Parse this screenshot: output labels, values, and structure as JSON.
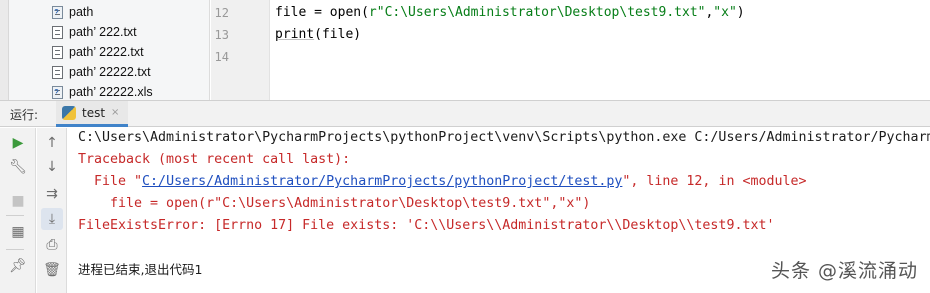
{
  "project_tree": {
    "items": [
      {
        "label": "path",
        "icon": "unknown-file-icon"
      },
      {
        "label": "path’ 222.txt",
        "icon": "text-file-icon"
      },
      {
        "label": "path’ 2222.txt",
        "icon": "text-file-icon"
      },
      {
        "label": "path’ 22222.txt",
        "icon": "text-file-icon"
      },
      {
        "label": "path’ 22222.xls",
        "icon": "unknown-file-icon"
      }
    ]
  },
  "editor": {
    "line_numbers": [
      "12",
      "13",
      "14"
    ],
    "lines": {
      "l12_a": "file = open(",
      "l12_b": "r\"C:\\Users\\Administrator\\Desktop\\test9.txt\"",
      "l12_c": ",",
      "l12_d": "\"x\"",
      "l12_e": ")",
      "l13_a": "print",
      "l13_b": "(file)"
    }
  },
  "run_window": {
    "title": "运行:",
    "tab_label": "test",
    "tab_close": "×"
  },
  "toolbar": {
    "left": [
      "run-icon",
      "wrench-icon",
      "stop-icon",
      "layout-icon",
      "pin-icon"
    ],
    "right": [
      "arrow-up-icon",
      "arrow-down-icon",
      "soft-wrap-icon",
      "scroll-to-end-icon",
      "print-icon",
      "trash-icon"
    ]
  },
  "console": {
    "command": "C:\\Users\\Administrator\\PycharmProjects\\pythonProject\\venv\\Scripts\\python.exe C:/Users/Administrator/Pycharm",
    "traceback_header": "Traceback (most recent call last):",
    "file_prefix": "  File \"",
    "file_link": "C:/Users/Administrator/PycharmProjects/pythonProject/test.py",
    "file_suffix": "\", line 12, in <module>",
    "code_line": "    file = open(r\"C:\\Users\\Administrator\\Desktop\\test9.txt\",\"x\")",
    "error": "FileExistsError: [Errno 17] File exists: 'C:\\\\Users\\\\Administrator\\\\Desktop\\\\test9.txt'",
    "exit_message": "进程已结束,退出代码1"
  },
  "watermark": "头条 @溪流涌动",
  "colors": {
    "error_red": "#c62929",
    "link_blue": "#1f4fbf",
    "string_green": "#067d17",
    "tab_accent": "#4083c9"
  }
}
